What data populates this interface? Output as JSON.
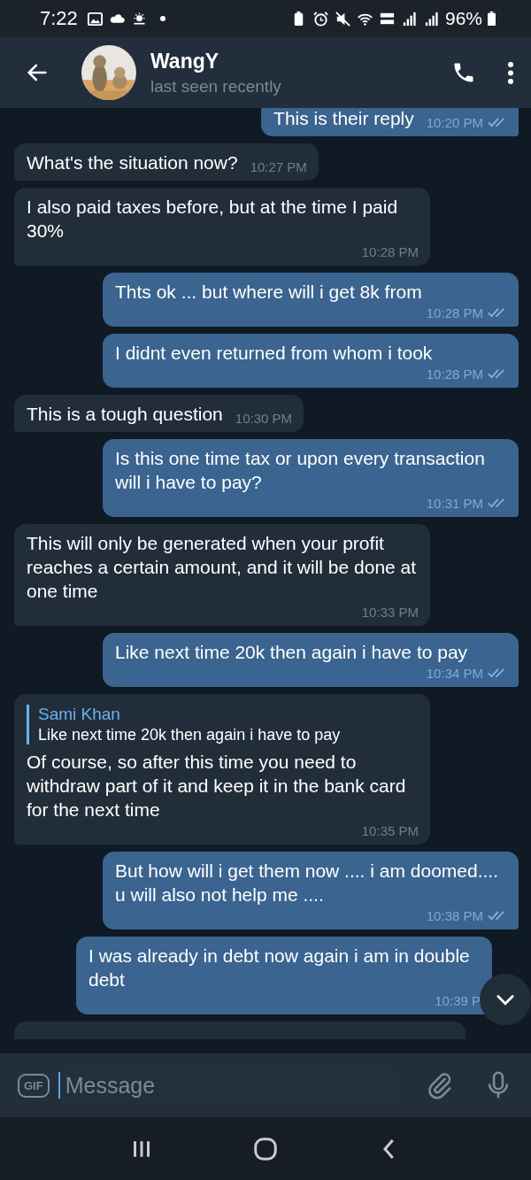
{
  "status_bar": {
    "time": "7:22",
    "battery": "96%"
  },
  "header": {
    "name": "WangY",
    "status": "last seen recently"
  },
  "messages": [
    {
      "kind": "out",
      "text": "This is their reply",
      "time": "10:20 PM",
      "read": true
    },
    {
      "kind": "in",
      "text": "What's the situation now?",
      "time": "10:27 PM"
    },
    {
      "kind": "in",
      "text": "I also paid taxes before, but at the time I paid 30%",
      "time": "10:28 PM"
    },
    {
      "kind": "out",
      "text": "Thts ok ... but where will i get 8k from",
      "time": "10:28 PM",
      "read": true
    },
    {
      "kind": "out",
      "text": "I didnt even returned from whom i took",
      "time": "10:28 PM",
      "read": true
    },
    {
      "kind": "in",
      "text": "This is a tough question",
      "time": "10:30 PM"
    },
    {
      "kind": "out",
      "text": "Is this one time tax or upon every transaction will i have to pay?",
      "time": "10:31 PM",
      "read": true
    },
    {
      "kind": "in",
      "text": "This will only be generated when your profit reaches a certain amount, and it will be done at one time",
      "time": "10:33 PM"
    },
    {
      "kind": "out",
      "text": "Like next time 20k then again i have to pay",
      "time": "10:34 PM",
      "read": true
    },
    {
      "kind": "in",
      "reply": {
        "name": "Sami Khan",
        "text": "Like next time 20k then again i have to pay"
      },
      "text": "Of course, so after this time you need to withdraw part of it and keep it in the bank card for the next time",
      "time": "10:35 PM"
    },
    {
      "kind": "out",
      "text": "But how will i get them now .... i am doomed.... u will also not help me ....",
      "time": "10:38 PM",
      "read": true
    },
    {
      "kind": "out",
      "text": "I was already in debt now again i am in double debt",
      "time": "10:39 P",
      "read": false
    },
    {
      "kind": "partial"
    }
  ],
  "composer": {
    "gif": "GIF",
    "placeholder": "Message"
  }
}
